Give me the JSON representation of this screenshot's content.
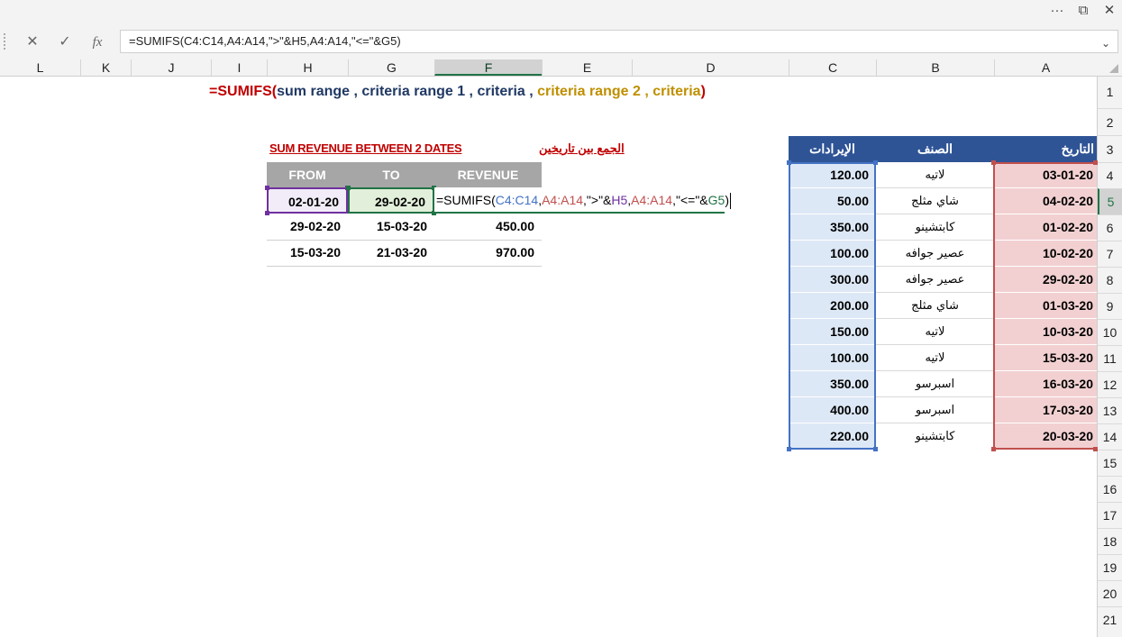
{
  "window": {
    "more_label": "···",
    "restore_label": "⧉",
    "close_label": "✕"
  },
  "formula_bar": {
    "cancel_label": "✕",
    "enter_label": "✓",
    "fx_label": "fx",
    "formula": "=SUMIFS(C4:C14,A4:A14,\">\"&H5,A4:A14,\"<=\"&G5)",
    "expand_label": "⌄"
  },
  "columns": [
    "L",
    "K",
    "J",
    "I",
    "H",
    "G",
    "F",
    "E",
    "D",
    "C",
    "B",
    "A"
  ],
  "selected_column": "F",
  "rows": [
    "1",
    "2",
    "3",
    "4",
    "5",
    "6",
    "7",
    "8",
    "9",
    "10",
    "11",
    "12",
    "13",
    "14",
    "15",
    "16",
    "17",
    "18",
    "19",
    "20",
    "21"
  ],
  "selected_row": "5",
  "syntax_line": {
    "eq": "=",
    "fn": "SUMIFS(",
    "part1": "sum range , criteria range 1 , criteria , ",
    "part2": "criteria range 2 ,  criteria",
    "close": ")"
  },
  "summary": {
    "title_en": "SUM REVENUE BETWEEN 2 DATES",
    "title_ar": "الجمع بين تاريخين",
    "headers": {
      "from": "FROM",
      "to": "TO",
      "revenue": "REVENUE"
    },
    "rows": [
      {
        "from": "02-01-20",
        "to": "29-02-20",
        "revenue": "=SUMIFS(C4:C14,A4:A14,\">\"&H5,A4:A14,\"<=\"&G5)"
      },
      {
        "from": "29-02-20",
        "to": "15-03-20",
        "revenue": "450.00"
      },
      {
        "from": "15-03-20",
        "to": "21-03-20",
        "revenue": "970.00"
      }
    ],
    "edit_formula": {
      "prefix": "=SUMIFS(",
      "ref_c": "C4:C14",
      "comma1": ",",
      "ref_a1": "A4:A14",
      "mid1": ",\">\"&",
      "ref_h5": "H5",
      "comma2": ",",
      "ref_a2": "A4:A14",
      "mid2": ",\"<=\"&",
      "ref_g5": "G5",
      "suffix": ")"
    }
  },
  "data_table": {
    "headers": {
      "revenue": "الإيرادات",
      "category": "الصنف",
      "date": "التاريخ"
    },
    "rows": [
      {
        "revenue": "120.00",
        "category": "لاتيه",
        "date": "03-01-20"
      },
      {
        "revenue": "50.00",
        "category": "شاي مثلج",
        "date": "04-02-20"
      },
      {
        "revenue": "350.00",
        "category": "كابتشينو",
        "date": "01-02-20"
      },
      {
        "revenue": "100.00",
        "category": "عصير جوافه",
        "date": "10-02-20"
      },
      {
        "revenue": "300.00",
        "category": "عصير جوافه",
        "date": "29-02-20"
      },
      {
        "revenue": "200.00",
        "category": "شاي مثلج",
        "date": "01-03-20"
      },
      {
        "revenue": "150.00",
        "category": "لاتيه",
        "date": "10-03-20"
      },
      {
        "revenue": "100.00",
        "category": "لاتيه",
        "date": "15-03-20"
      },
      {
        "revenue": "350.00",
        "category": "اسبرسو",
        "date": "16-03-20"
      },
      {
        "revenue": "400.00",
        "category": "اسبرسو",
        "date": "17-03-20"
      },
      {
        "revenue": "220.00",
        "category": "كابتشينو",
        "date": "20-03-20"
      }
    ]
  },
  "colors": {
    "header_blue": "#2f5496",
    "range_blue": "#4472c4",
    "range_red": "#c0504d",
    "range_purple": "#7030a0",
    "range_green": "#217346",
    "title_red": "#c00000"
  }
}
